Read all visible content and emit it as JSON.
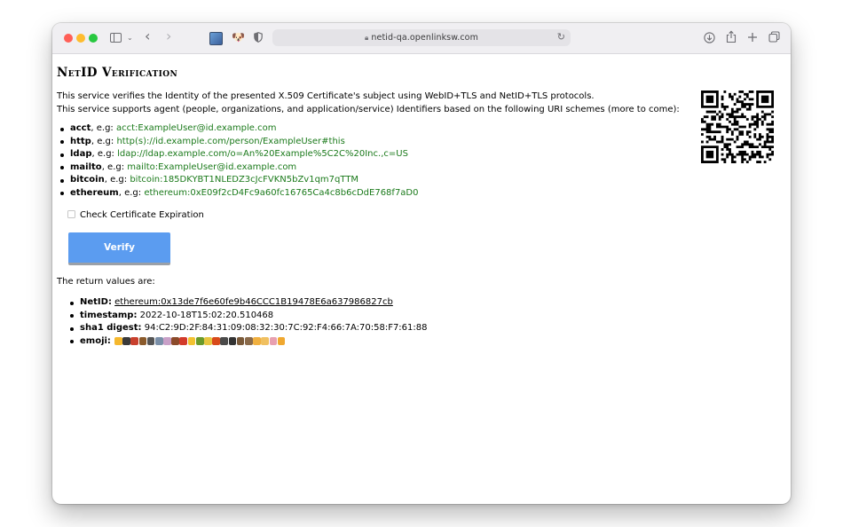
{
  "browser": {
    "url": "netid-qa.openlinksw.com"
  },
  "page": {
    "title": "NetID Verification",
    "intro_line1": "This service verifies the Identity of the presented X.509 Certificate's subject using WebID+TLS and NetID+TLS protocols.",
    "intro_line2": "This service supports agent (people, organizations, and application/service) Identifiers based on the following URI schemes (more to come):",
    "schemes": [
      {
        "name": "acct",
        "sep": ", e.g: ",
        "example": "acct:ExampleUser@id.example.com"
      },
      {
        "name": "http",
        "sep": ", e.g: ",
        "example": "http(s)://id.example.com/person/ExampleUser#this"
      },
      {
        "name": "ldap",
        "sep": ", e.g: ",
        "example": "ldap://ldap.example.com/o=An%20Example%5C2C%20Inc.,c=US"
      },
      {
        "name": "mailto",
        "sep": ", e.g: ",
        "example": "mailto:ExampleUser@id.example.com"
      },
      {
        "name": "bitcoin",
        "sep": ", e.g: ",
        "example": "bitcoin:185DKYBT1NLEDZ3cJcFVKN5bZv1qm7qTTM"
      },
      {
        "name": "ethereum",
        "sep": ", e.g: ",
        "example": "ethereum:0xE09f2cD4Fc9a60fc16765Ca4c8b6cDdE768f7aD0"
      }
    ],
    "check_label": "Check Certificate Expiration",
    "verify_label": "Verify",
    "return_intro": "The return values are:",
    "returns": {
      "netid_label": "NetID:",
      "netid_value": "ethereum:0x13de7f6e60fe9b46CCC1B19478E6a637986827cb",
      "timestamp_label": "timestamp:",
      "timestamp_value": "2022-10-18T15:02:20.510468",
      "sha1_label": "sha1 digest:",
      "sha1_value": "94:C2:9D:2F:84:31:09:08:32:30:7C:92:F4:66:7A:70:58:F7:61:88",
      "emoji_label": "emoji:"
    }
  },
  "colors": {
    "example_text": "#1b7a1b",
    "verify_button": "#5b9cf0"
  }
}
